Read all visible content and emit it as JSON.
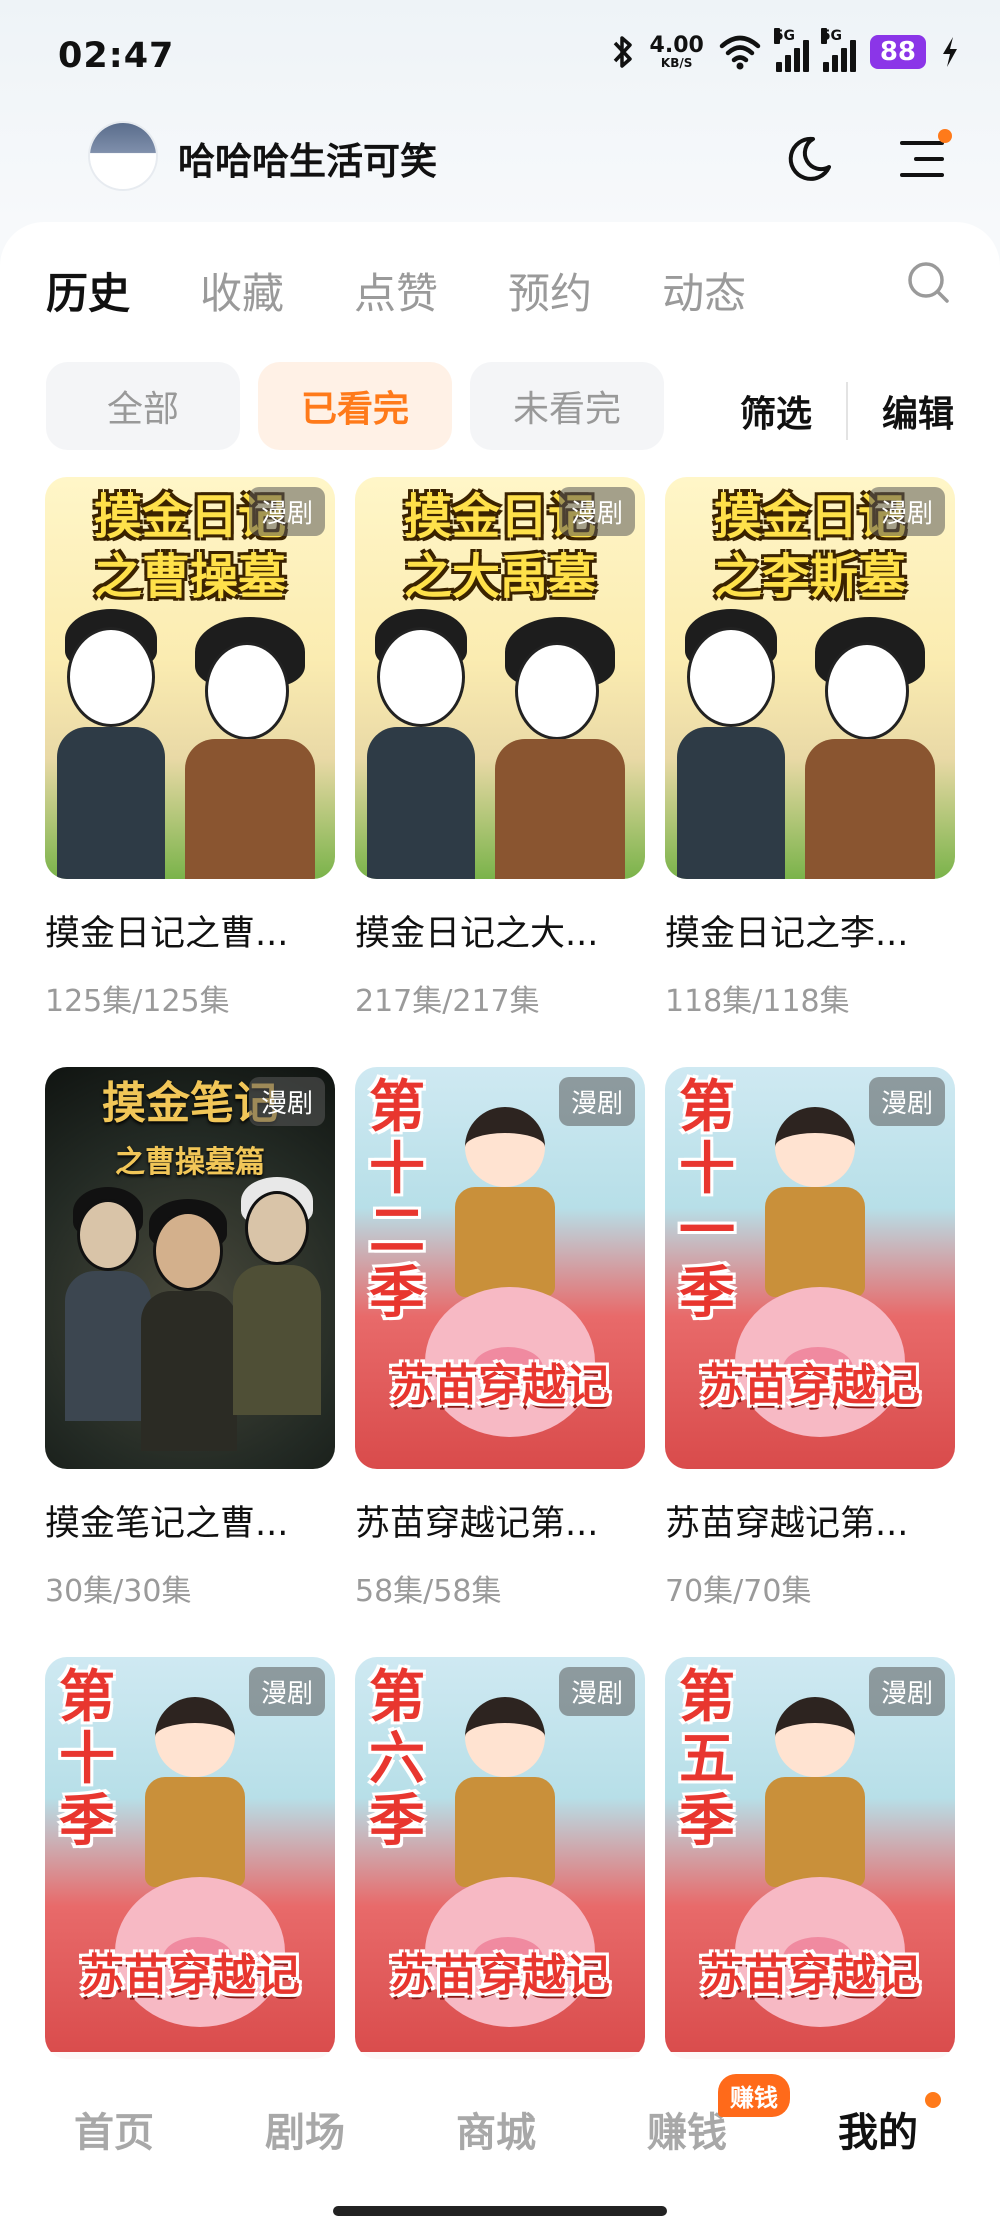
{
  "status_bar": {
    "time": "02:47",
    "net_speed": "4.00",
    "net_unit": "KB/S",
    "signal1_label": "5G",
    "signal2_label": "5G",
    "battery": "88",
    "icons": [
      "bluetooth-icon",
      "wifi-icon",
      "signal-icon",
      "signal-icon",
      "battery-icon",
      "charging-icon"
    ]
  },
  "header": {
    "username": "哈哈哈生活可笑",
    "icons": [
      "moon-icon",
      "menu-icon"
    ],
    "accent": "#ff7a1a"
  },
  "tabs": [
    {
      "label": "历史"
    },
    {
      "label": "收藏"
    },
    {
      "label": "点赞"
    },
    {
      "label": "预约"
    },
    {
      "label": "动态"
    }
  ],
  "filters": [
    {
      "label": "全部"
    },
    {
      "label": "已看完"
    },
    {
      "label": "未看完"
    }
  ],
  "actions": {
    "filter": "筛选",
    "edit": "编辑"
  },
  "items": [
    {
      "title": "摸金日记之曹...",
      "episodes": "125集/125集",
      "badge": "漫剧",
      "poster_line1": "摸金日记",
      "poster_line2": "之曹操墓"
    },
    {
      "title": "摸金日记之大...",
      "episodes": "217集/217集",
      "badge": "漫剧",
      "poster_line1": "摸金日记",
      "poster_line2": "之大禹墓"
    },
    {
      "title": "摸金日记之李...",
      "episodes": "118集/118集",
      "badge": "漫剧",
      "poster_line1": "摸金日记",
      "poster_line2": "之李斯墓"
    },
    {
      "title": "摸金笔记之曹...",
      "episodes": "30集/30集",
      "badge": "漫剧",
      "poster_line1": "摸金笔记",
      "poster_line2": "之曹操墓篇"
    },
    {
      "title": "苏苗穿越记第...",
      "episodes": "58集/58集",
      "badge": "漫剧",
      "poster_season": "第十二季",
      "poster_banner": "苏苗穿越记"
    },
    {
      "title": "苏苗穿越记第...",
      "episodes": "70集/70集",
      "badge": "漫剧",
      "poster_season": "第十一季",
      "poster_banner": "苏苗穿越记"
    },
    {
      "badge": "漫剧",
      "poster_season": "第十季",
      "poster_banner": "苏苗穿越记"
    },
    {
      "badge": "漫剧",
      "poster_season": "第六季",
      "poster_banner": "苏苗穿越记"
    },
    {
      "badge": "漫剧",
      "poster_season": "第五季",
      "poster_banner": "苏苗穿越记"
    }
  ],
  "nav": [
    {
      "label": "首页"
    },
    {
      "label": "剧场"
    },
    {
      "label": "商城"
    },
    {
      "label": "赚钱"
    },
    {
      "label": "我的"
    }
  ],
  "nav_badge": "赚钱"
}
